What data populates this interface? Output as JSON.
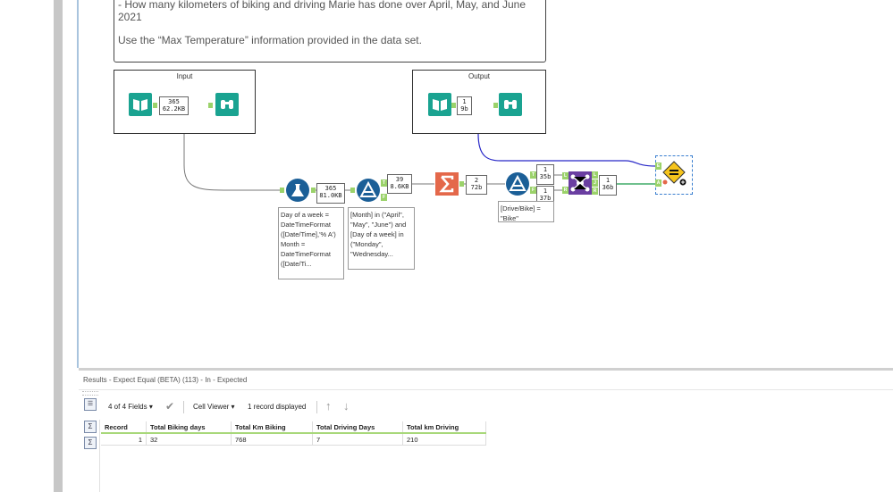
{
  "comment": {
    "line1": "- How many kilometers of biking and driving Marie has done over April, May, and June",
    "line2": "2021",
    "line3": "Use the “Max Temperature” information provided in the data set."
  },
  "containers": {
    "input_title": "Input",
    "output_title": "Output"
  },
  "badges": {
    "input": [
      "365",
      "62.2KB"
    ],
    "output": [
      "1",
      "9b"
    ],
    "formula": [
      "365",
      "81.0KB"
    ],
    "filter1": [
      "39",
      "8.6KB"
    ],
    "summarize": [
      "2",
      "72b"
    ],
    "filter2_true": [
      "1",
      "35b"
    ],
    "filter2_false": [
      "1",
      "37b"
    ],
    "join": [
      "1",
      "36b"
    ]
  },
  "annotations": {
    "formula": "Day of a week = DateTimeFormat ([Date/Time],'% A') Month = DateTimeFormat ([Date/Ti...",
    "filter1": "[Month] in (\"April\", \"May\", \"June\") and [Day of a week] in (\"Monday\", \"Wednesday...",
    "filter2": "[Drive/Bike] = \"Bike\""
  },
  "anchors": {
    "T": "T",
    "F": "F",
    "L": "L",
    "J": "J",
    "R": "R",
    "E": "E",
    "A": "A"
  },
  "results": {
    "title": "Results - Expect Equal (BETA) (113) - In - Expected",
    "fields": "4 of 4 Fields",
    "viewer": "Cell Viewer",
    "records": "1 record displayed",
    "columns": [
      "Record",
      "Total Biking days",
      "Total Km Biking",
      "Total Driving Days",
      "Total km Driving"
    ],
    "rows": [
      [
        "1",
        "32",
        "768",
        "7",
        "210"
      ]
    ]
  },
  "colors": {
    "teal": "#1aa391",
    "blue": "#1b5f97",
    "orange": "#e4684a",
    "purple": "#6a3ea1",
    "yellow": "#f6c41c",
    "anchor_green": "#9bd26a"
  },
  "icons": {
    "input": "book-icon",
    "browse": "binoculars-icon",
    "formula": "flask-icon",
    "filter": "filter-icon",
    "summarize": "sigma-icon",
    "join": "join-icon",
    "expect": "expect-equal-icon"
  }
}
